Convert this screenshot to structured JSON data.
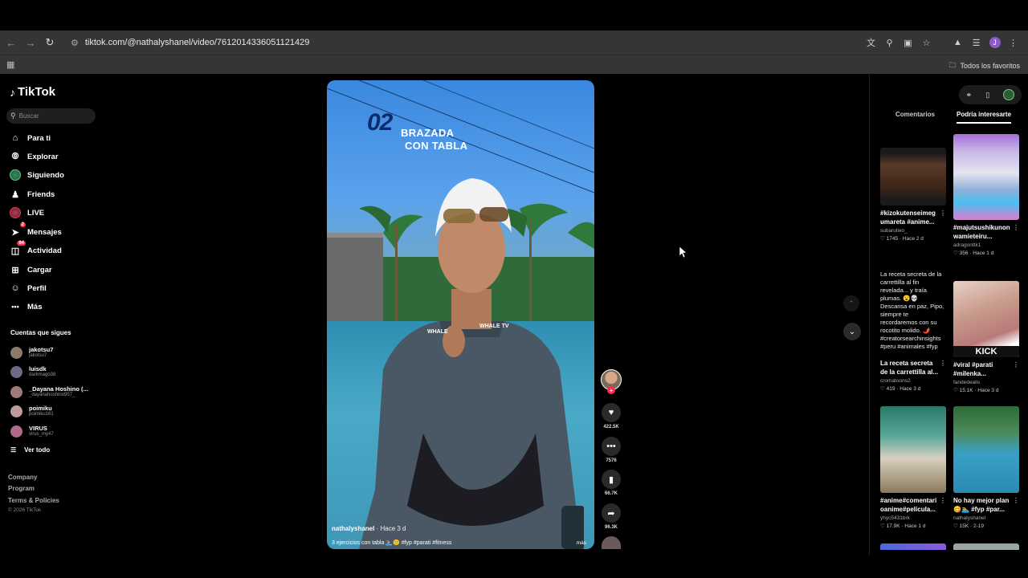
{
  "browser": {
    "url": "tiktok.com/@nathalyshanel/video/7612014336051121429",
    "profile_initial": "J",
    "bookmarks_label": "Todos los favoritos"
  },
  "sidebar": {
    "logo": "TikTok",
    "search_placeholder": "Buscar",
    "nav": [
      {
        "label": "Para ti",
        "icon": "home-icon"
      },
      {
        "label": "Explorar",
        "icon": "compass-icon"
      },
      {
        "label": "Siguiendo",
        "icon": "following-avatar-icon"
      },
      {
        "label": "Friends",
        "icon": "friends-icon"
      },
      {
        "label": "LIVE",
        "icon": "live-avatar-icon"
      },
      {
        "label": "Mensajes",
        "icon": "send-icon",
        "badge": "2"
      },
      {
        "label": "Actividad",
        "icon": "inbox-icon",
        "badge": "94"
      },
      {
        "label": "Cargar",
        "icon": "upload-icon"
      },
      {
        "label": "Perfil",
        "icon": "profile-icon"
      },
      {
        "label": "Más",
        "icon": "more-dots-icon"
      }
    ],
    "following_title": "Cuentas que sigues",
    "following": [
      {
        "name": "jakotsu7",
        "handle": "jakotsu7"
      },
      {
        "name": "luisdk",
        "handle": "darkmago38"
      },
      {
        "name": "_Dayana Hoshino (...",
        "handle": "_dayanahoshino957_"
      },
      {
        "name": "poimiku",
        "handle": "poimiku161"
      },
      {
        "name": "VIRUS",
        "handle": "virus_my47"
      }
    ],
    "see_all": "Ver todo",
    "footer": [
      "Company",
      "Program",
      "Terms & Policies"
    ],
    "copyright": "© 2026 TikTok"
  },
  "video": {
    "overlay_number": "02",
    "overlay_line1": "BRAZADA",
    "overlay_line2": "CON TABLA",
    "author": "nathalyshanel",
    "time_ago": "· Hace 3 d",
    "description": "3 ejercicios con tabla 🏊‍♀️🙂 #fyp #parati #fitness",
    "more": "más",
    "shirt_logo_left": "WHALE",
    "shirt_logo_right": "WHALE TV"
  },
  "actions": {
    "likes": "422.5K",
    "comments": "7576",
    "saves": "66.7K",
    "shares": "96.3K"
  },
  "right_panel": {
    "tabs": [
      "Comentarios",
      "Podría interesarte"
    ],
    "cards": [
      {
        "title": "#kizokutenseimeg umareta #anime...",
        "user": "subarutwo_",
        "likes": "1745",
        "time": "Hace 2 d"
      },
      {
        "title": "#majutsushikunon wamieteiru...",
        "user": "adragonttk1",
        "likes": "356",
        "time": "Hace 1 d"
      },
      {
        "alt": "La receta secreta de la carrettilla al fin revelada... y traía plumas. 😮💀 Descansa en paz, Pipo, siempre te recordaremos con su rocotito molido. 🌶️ #creatorsearchinsights #peru #animales #fyp",
        "title": "La receta secreta de la carrettilla al...",
        "user": "cromatoons2",
        "likes": "419",
        "time": "Hace 3 d"
      },
      {
        "title": "#viral #parati #milenka...",
        "user": "fandedealis",
        "likes": "15.1K",
        "time": "Hace 3 d",
        "thumb_text": "KICK"
      },
      {
        "title": "#anime#comentari oanime#pelicula...",
        "user": "yhyc5431brk",
        "likes": "17.9K",
        "time": "Hace 1 d"
      },
      {
        "title": "No hay mejor plan 😋🏊 #fyp #par...",
        "user": "nathalyshanel",
        "likes": "15K",
        "time": "2-19"
      }
    ]
  }
}
